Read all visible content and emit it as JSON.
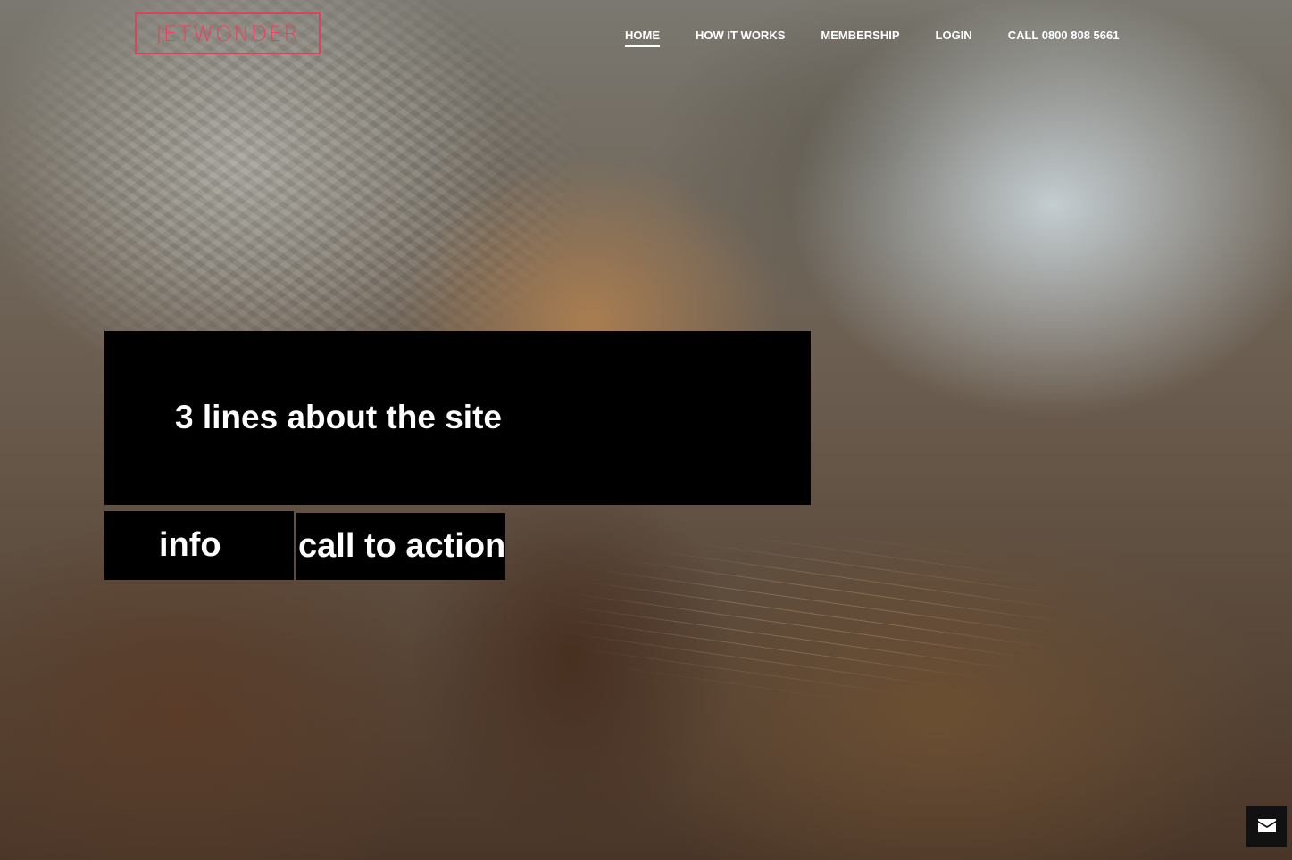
{
  "logo": {
    "text": "JETWONDER",
    "color": "#ee3f5c"
  },
  "nav": {
    "items": [
      {
        "label": "HOME",
        "active": true
      },
      {
        "label": "HOW IT WORKS",
        "active": false
      },
      {
        "label": "MEMBERSHIP",
        "active": false
      },
      {
        "label": "LOGIN",
        "active": false
      },
      {
        "label": "CALL 0800 808 5661",
        "active": false
      }
    ]
  },
  "hero": {
    "about_text": "3 lines about the site",
    "info_label": "info",
    "cta_label": "call to action"
  },
  "contact_button": {
    "icon": "envelope-icon"
  }
}
